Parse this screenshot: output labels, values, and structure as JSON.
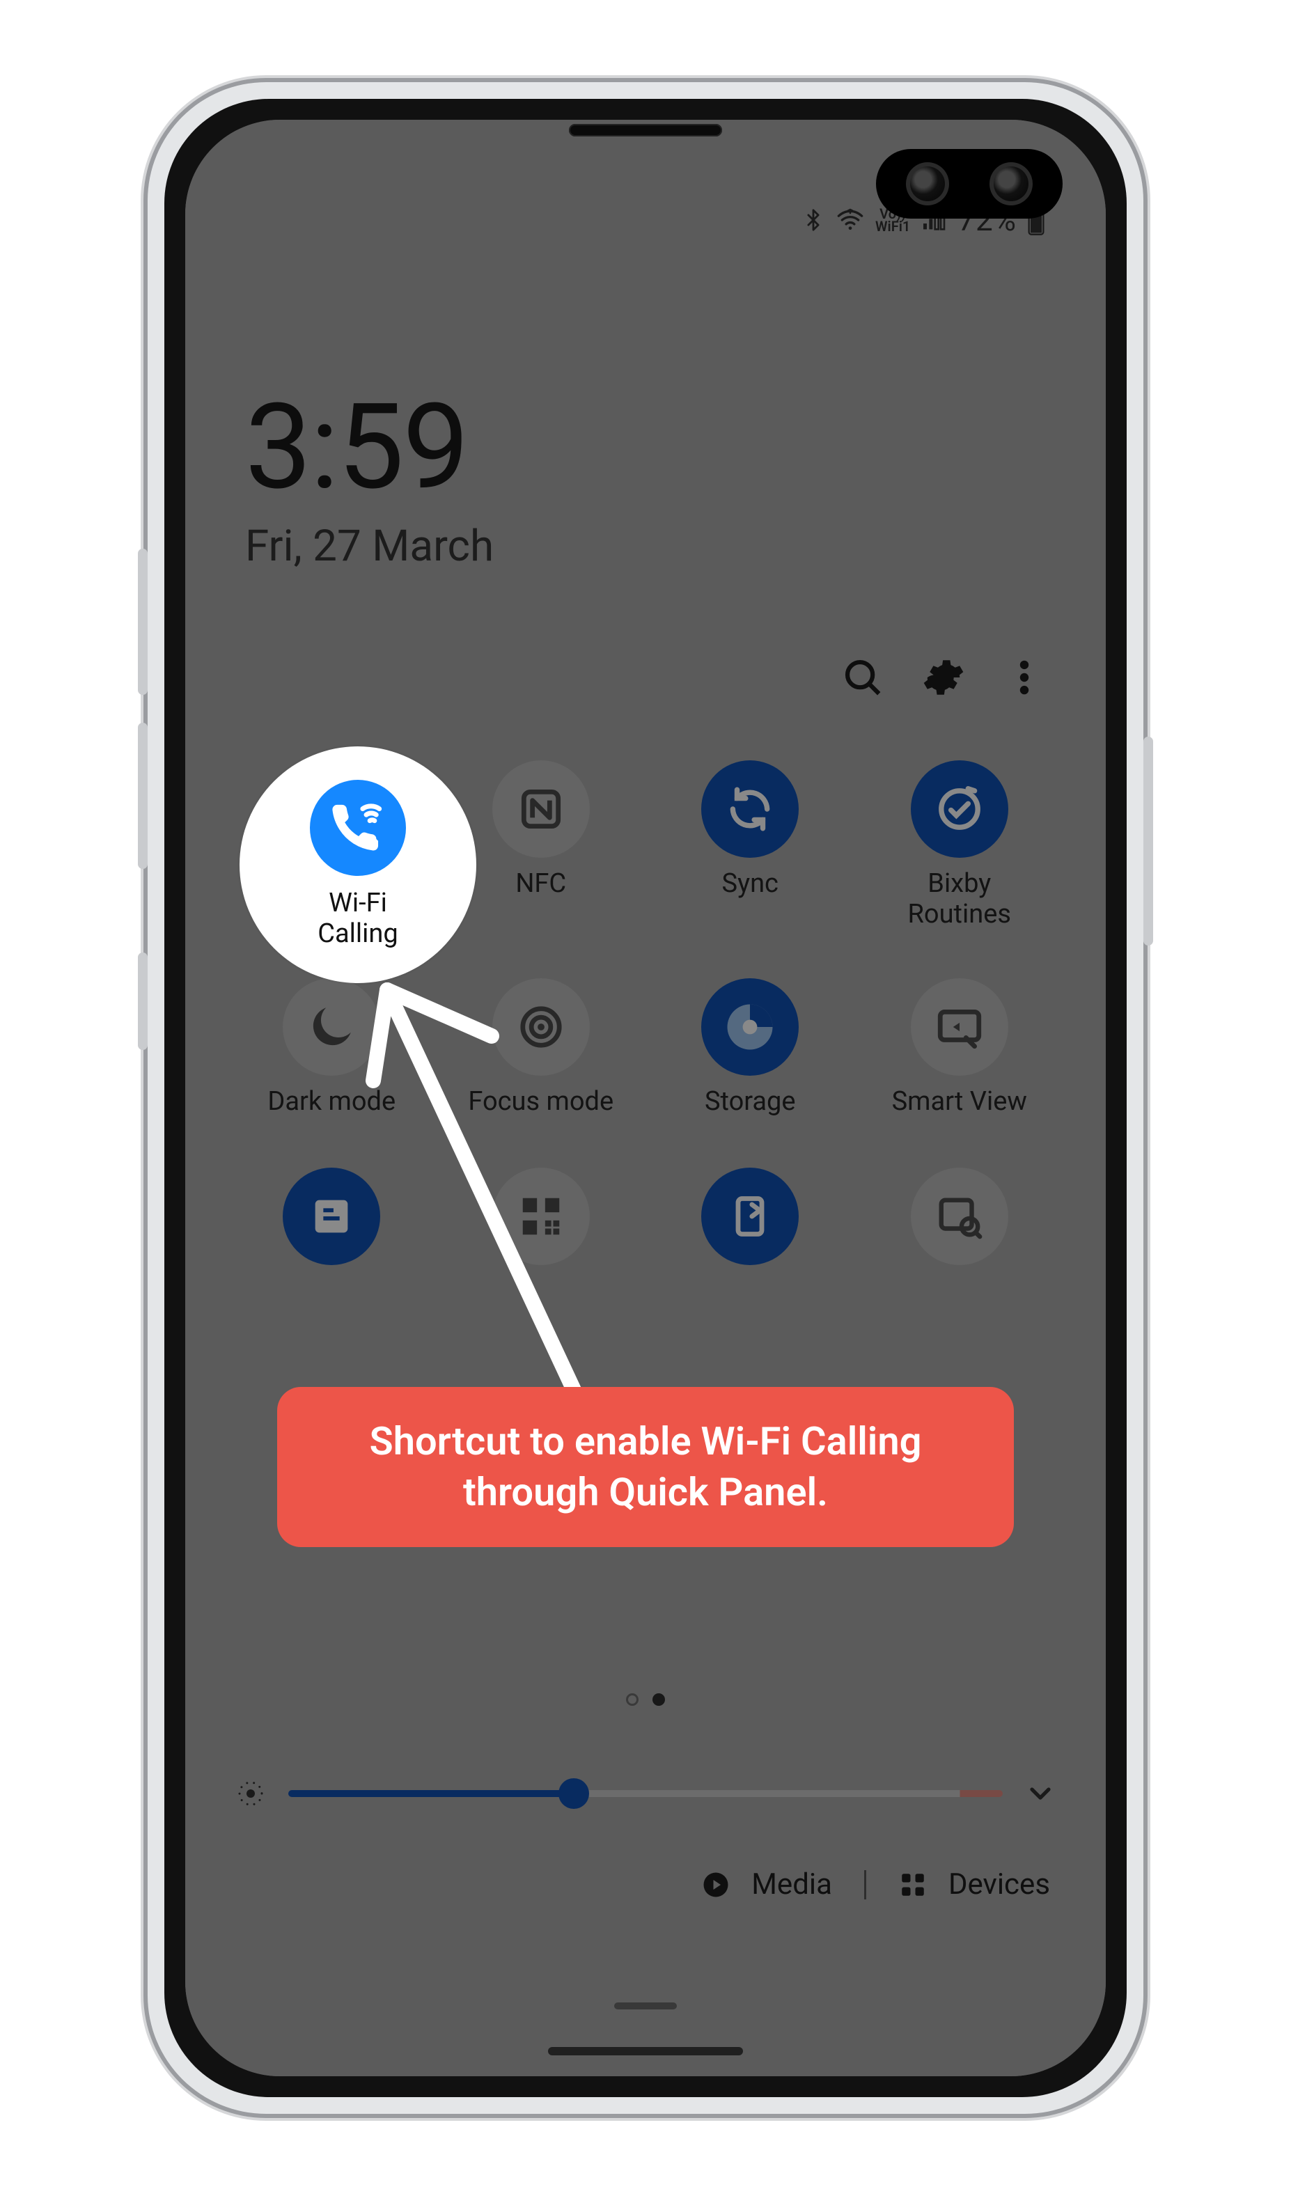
{
  "status": {
    "battery_percent": "72%",
    "icons": [
      "bluetooth",
      "wifi",
      "vowifi",
      "signal"
    ]
  },
  "clock": {
    "time": "3:59",
    "date": "Fri, 27 March"
  },
  "actions": {
    "search": "Search",
    "settings": "Settings",
    "more": "More"
  },
  "highlight": {
    "label": "Wi-Fi\nCalling",
    "icon": "wifi-calling"
  },
  "grid": {
    "rows": [
      [
        {
          "label": "Wi-Fi\nCalling",
          "state": "active",
          "icon": "wifi-calling"
        },
        {
          "label": "NFC",
          "state": "inactive",
          "icon": "nfc"
        },
        {
          "label": "Sync",
          "state": "active",
          "icon": "sync"
        },
        {
          "label": "Bixby\nRoutines",
          "state": "active",
          "icon": "bixby"
        }
      ],
      [
        {
          "label": "Dark mode",
          "state": "inactive",
          "icon": "moon"
        },
        {
          "label": "Focus mode",
          "state": "inactive",
          "icon": "target"
        },
        {
          "label": "Storage",
          "state": "active",
          "icon": "disc"
        },
        {
          "label": "Smart View",
          "state": "inactive",
          "icon": "cast"
        }
      ],
      [
        {
          "label": "",
          "state": "active",
          "icon": "clock-square"
        },
        {
          "label": "",
          "state": "inactive",
          "icon": "qr"
        },
        {
          "label": "",
          "state": "active",
          "icon": "door"
        },
        {
          "label": "",
          "state": "inactive",
          "icon": "find"
        }
      ]
    ]
  },
  "callout": {
    "text": "Shortcut to enable Wi-Fi Calling through Quick Panel."
  },
  "pager": {
    "page": 2,
    "total": 2
  },
  "brightness": {
    "value_percent": 40
  },
  "bottom": {
    "media": "Media",
    "devices": "Devices"
  }
}
